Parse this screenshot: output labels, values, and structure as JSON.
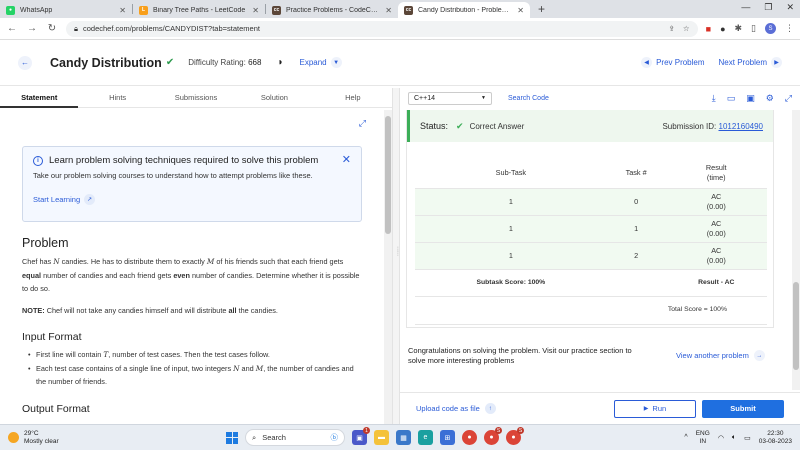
{
  "browser": {
    "tabs": [
      {
        "title": "WhatsApp",
        "active": false,
        "favicon_color": "#25d366",
        "favicon_icon": "whatsapp-icon"
      },
      {
        "title": "Binary Tree Paths - LeetCode",
        "active": false,
        "favicon_color": "#f89f1b",
        "favicon_icon": "leetcode-icon"
      },
      {
        "title": "Practice Problems - CodeChef",
        "active": false,
        "favicon_color": "#5b4638",
        "favicon_icon": "codechef-icon"
      },
      {
        "title": "Candy Distribution - Problems -",
        "active": true,
        "favicon_color": "#5b4638",
        "favicon_icon": "codechef-icon"
      }
    ],
    "url": "codechef.com/problems/CANDYDIST?tab=statement",
    "profile_initial": "S"
  },
  "problem": {
    "title": "Candy Distribution",
    "difficulty_label": "Difficulty Rating:",
    "difficulty_value": "668",
    "expand_label": "Expand",
    "prev_label": "Prev Problem",
    "next_label": "Next Problem"
  },
  "left_tabs": [
    "Statement",
    "Hints",
    "Submissions",
    "Solution",
    "Help"
  ],
  "learn_box": {
    "title": "Learn problem solving techniques required to solve this problem",
    "description": "Take our problem solving courses to understand how to attempt problems like these.",
    "link": "Start Learning"
  },
  "statement": {
    "heading": "Problem",
    "p1_a": "Chef has ",
    "p1_N": "N",
    "p1_b": " candies. He has to distribute them to exactly ",
    "p1_M": "M",
    "p1_c": " of his friends such that each friend gets ",
    "p1_equal": "equal",
    "p1_d": " number of candies and each friend gets ",
    "p1_even": "even",
    "p1_e": " number of candies. Determine whether it is possible to do so.",
    "note_label": "NOTE:",
    "note_a": " Chef will not take any candies himself and will distribute ",
    "note_all": "all",
    "note_b": " the candies.",
    "input_heading": "Input Format",
    "input_1a": "First line will contain ",
    "input_1T": "T",
    "input_1b": ", number of test cases. Then the test cases follow.",
    "input_2a": "Each test case contains of a single line of input, two integers ",
    "input_2N": "N",
    "input_2and": " and ",
    "input_2M": "M",
    "input_2b": ", the number of candies and the number of friends.",
    "output_heading": "Output Format"
  },
  "editor": {
    "language": "C++14",
    "search_code": "Search Code"
  },
  "result": {
    "status_label": "Status:",
    "status_value": "Correct Answer",
    "submission_label": "Submission ID:",
    "submission_id": "1012160490",
    "headers": {
      "subtask": "Sub-Task",
      "task": "Task #",
      "result": "Result",
      "result_sub": "(time)"
    },
    "rows": [
      {
        "subtask": "1",
        "task": "0",
        "result": "AC",
        "time": "(0.00)"
      },
      {
        "subtask": "1",
        "task": "1",
        "result": "AC",
        "time": "(0.00)"
      },
      {
        "subtask": "1",
        "task": "2",
        "result": "AC",
        "time": "(0.00)"
      }
    ],
    "subtask_score": "Subtask Score: 100%",
    "subtask_result": "Result - AC",
    "total_score": "Total Score = 100%",
    "congrats": "Congratulations on solving the problem. Visit our practice section to solve more interesting problems",
    "view_another": "View another problem"
  },
  "actions": {
    "upload": "Upload code as file",
    "run": "Run",
    "submit": "Submit"
  },
  "taskbar": {
    "temp": "29°C",
    "weather": "Mostly clear",
    "search": "Search",
    "lang_top": "ENG",
    "lang_bottom": "IN",
    "time": "22:30",
    "date": "03-08-2023"
  },
  "colors": {
    "accent": "#2a5bd7",
    "success": "#3cae58",
    "submit": "#1f6fe0"
  }
}
